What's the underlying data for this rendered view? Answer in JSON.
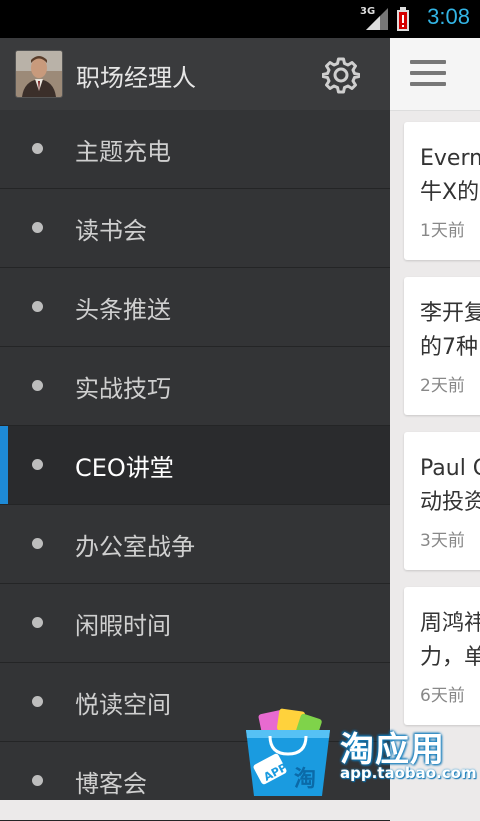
{
  "status_bar": {
    "network": "3G",
    "time": "3:08"
  },
  "drawer": {
    "title": "职场经理人",
    "items": [
      {
        "label": "主题充电",
        "active": false
      },
      {
        "label": "读书会",
        "active": false
      },
      {
        "label": "头条推送",
        "active": false
      },
      {
        "label": "实战技巧",
        "active": false
      },
      {
        "label": "CEO讲堂",
        "active": true
      },
      {
        "label": "办公室战争",
        "active": false
      },
      {
        "label": "闲暇时间",
        "active": false
      },
      {
        "label": "悦读空间",
        "active": false
      },
      {
        "label": "博客会",
        "active": false
      }
    ],
    "accent_color": "#1e8ad6"
  },
  "feed": {
    "cards": [
      {
        "title": "Everm\n牛X的",
        "time": "1天前"
      },
      {
        "title": "李开复\n的7种",
        "time": "2天前"
      },
      {
        "title": "Paul G\n动投资",
        "time": "3天前"
      },
      {
        "title": "周鸿祎\n力，单",
        "time": "6天前"
      }
    ]
  },
  "watermark": {
    "brand": "淘应用",
    "url": "app.taobao.com",
    "bag_text": "淘",
    "bag_tag": "APP"
  }
}
